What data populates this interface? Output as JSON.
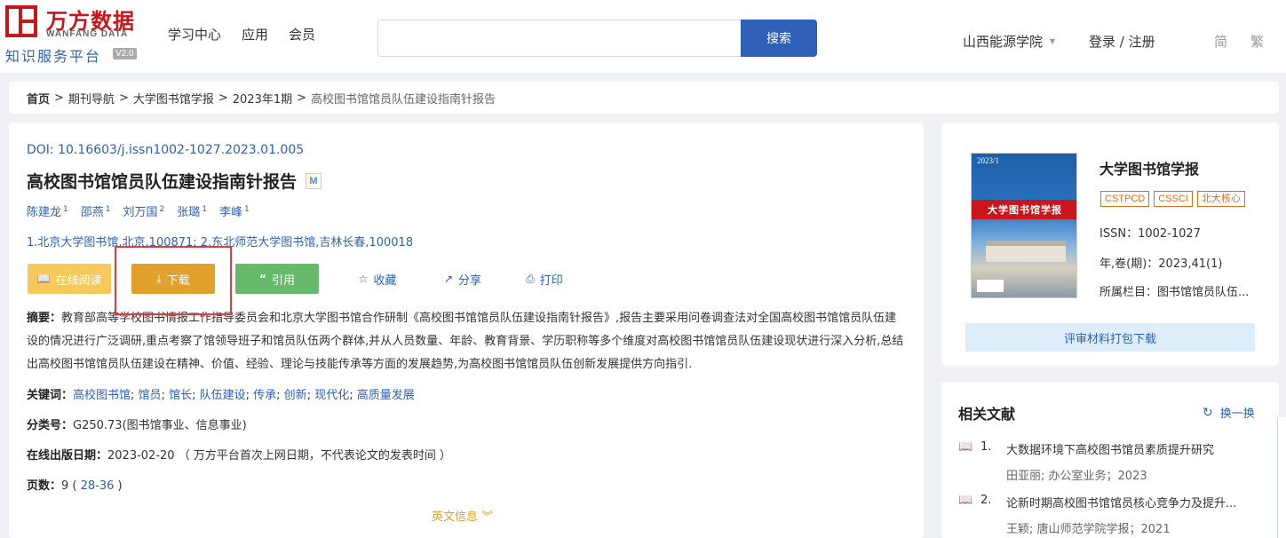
{
  "header": {
    "logo_cn": "万方数据",
    "logo_en": "WANFANG DATA",
    "logo_sub": "知识服务平台",
    "version": "V2.0",
    "nav": [
      "学习中心",
      "应用",
      "会员"
    ],
    "search_value": "",
    "search_button": "搜索",
    "institution": "山西能源学院",
    "login": "登录 / 注册",
    "lang_simplified": "简",
    "lang_traditional": "繁"
  },
  "breadcrumb": {
    "home": "首页",
    "journal_nav": "期刊导航",
    "journal": "大学图书馆学报",
    "issue": "2023年1期",
    "current": "高校图书馆馆员队伍建设指南针报告"
  },
  "article": {
    "doi_label": "DOI:",
    "doi": "10.16603/j.issn1002-1027.2023.01.005",
    "title": "高校图书馆馆员队伍建设指南针报告",
    "title_badge": "M",
    "authors": [
      {
        "name": "陈建龙",
        "sup": "1"
      },
      {
        "name": "邵燕",
        "sup": "1"
      },
      {
        "name": "刘万国",
        "sup": "2"
      },
      {
        "name": "张璐",
        "sup": "1"
      },
      {
        "name": "李峰",
        "sup": "1"
      }
    ],
    "affiliation": "1.北京大学图书馆,北京,100871; 2.东北师范大学图书馆,吉林长春,100018",
    "actions": {
      "read_online": "在线阅读",
      "download": "下载",
      "cite": "引用",
      "favorite": "收藏",
      "share": "分享",
      "print": "打印"
    },
    "abstract_label": "摘要：",
    "abstract": "教育部高等学校图书情报工作指导委员会和北京大学图书馆合作研制《高校图书馆馆员队伍建设指南针报告》,报告主要采用问卷调查法对全国高校图书馆馆员队伍建设的情况进行广泛调研,重点考察了馆领导班子和馆员队伍两个群体,并从人员数量、年龄、教育背景、学历职称等多个维度对高校图书馆馆员队伍建设现状进行深入分析,总结出高校图书馆馆员队伍建设在精神、价值、经验、理论与技能传承等方面的发展趋势,为高校图书馆馆员队伍创新发展提供方向指引.",
    "keywords_label": "关键词：",
    "keywords": [
      "高校图书馆",
      "馆员",
      "馆长",
      "队伍建设",
      "传承",
      "创新",
      "现代化",
      "高质量发展"
    ],
    "class_label": "分类号：",
    "class_value": "G250.73(图书馆事业、信息事业)",
    "pubdate_label": "在线出版日期：",
    "pubdate_value": "2023-02-20 （ 万方平台首次上网日期，不代表论文的发表时间 ）",
    "pages_label": "页数：",
    "pages_count": "9",
    "pages_range": "28-36",
    "english_info": "英文信息"
  },
  "journal_card": {
    "cover_year": "2023/1",
    "cover_title": "大学图书馆学报",
    "name": "大学图书馆学报",
    "tags": [
      "CSTPCD",
      "CSSCI",
      "北大核心"
    ],
    "issn": "ISSN：1002-1027",
    "volume": "年,卷(期)：2023,41(1)",
    "column": "所属栏目：图书馆馆员队伍...",
    "pack_download": "评审材料打包下载"
  },
  "related": {
    "heading": "相关文献",
    "refresh": "换一换",
    "items": [
      {
        "num": "1.",
        "title": "大数据环境下高校图书馆员素质提升研究",
        "meta": "田亚丽; 办公室业务；2023"
      },
      {
        "num": "2.",
        "title": "论新时期高校图书馆馆员核心竞争力及提升...",
        "meta": "王颖; 唐山师范学院学报；2021"
      }
    ]
  },
  "colors": {
    "brand_red": "#c8161d",
    "link_blue": "#2f60b8",
    "download_orange": "#e2a12c",
    "cite_green": "#66bb6a",
    "highlight_red": "#e53935"
  }
}
